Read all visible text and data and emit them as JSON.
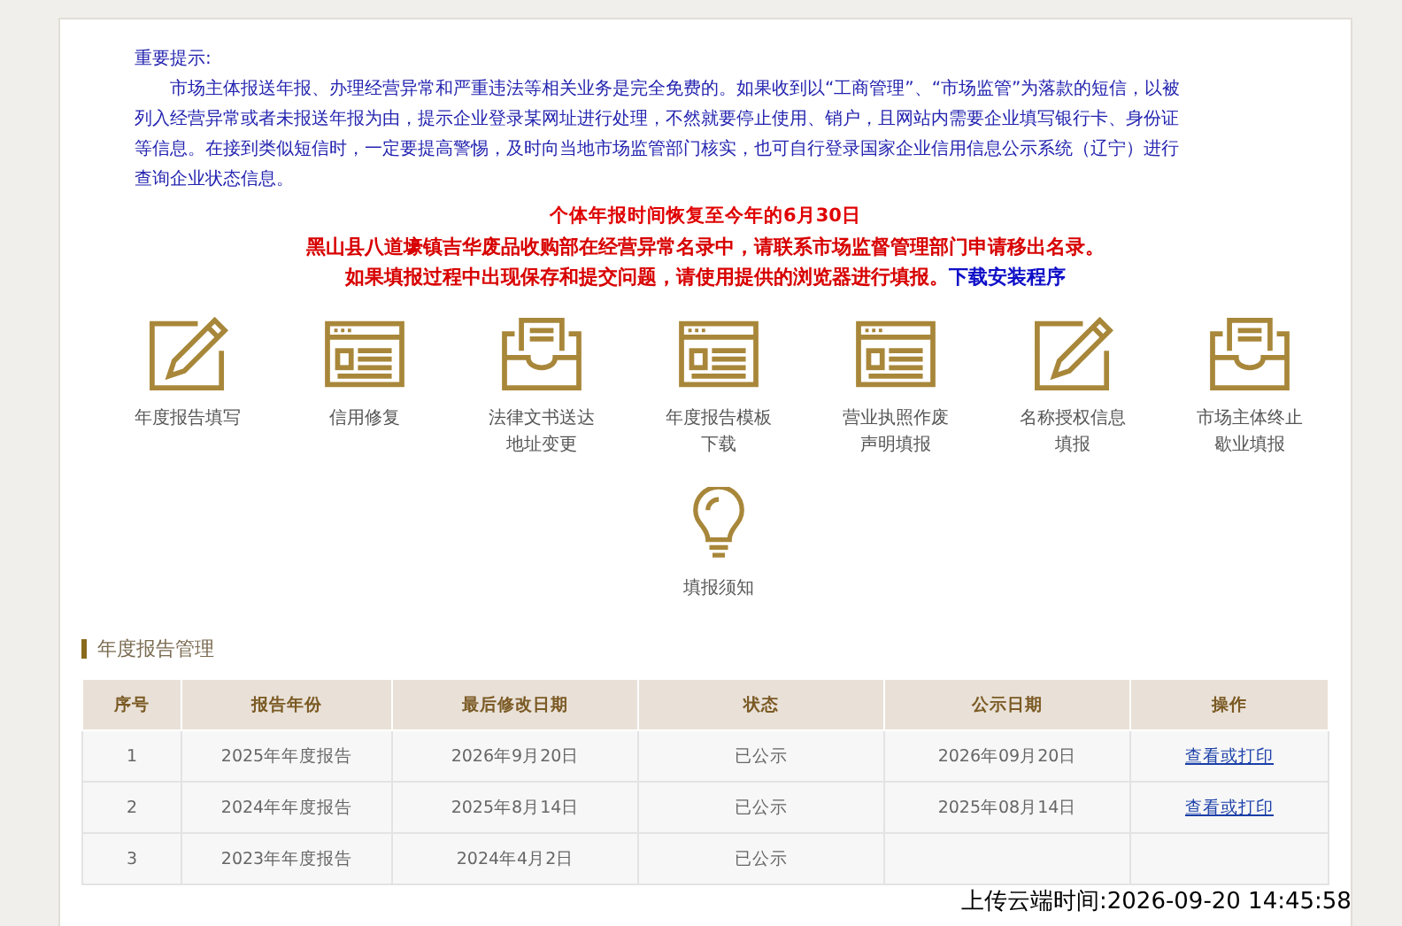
{
  "notice": {
    "heading": "重要提示:",
    "body": "市场主体报送年报、办理经营异常和严重违法等相关业务是完全免费的。如果收到以“工商管理”、“市场监管”为落款的短信，以被列入经营异常或者未报送年报为由，提示企业登录某网址进行处理，不然就要停止使用、销户，且网站内需要企业填写银行卡、身份证等信息。在接到类似短信时，一定要提高警惕，及时向当地市场监管部门核实，也可自行登录国家企业信用信息公示系统（辽宁）进行查询企业状态信息。"
  },
  "alerts": {
    "line_1": "个体年报时间恢复至今年的6月30日",
    "line_2": "黑山县八道壕镇吉华废品收购部在经营异常名录中，请联系市场监督管理部门申请移出名录。",
    "line_3": "如果填报过程中出现保存和提交问题，请使用提供的浏览器进行填报。",
    "download_link": "下载安装程序"
  },
  "services": [
    {
      "kind": "pencil",
      "label": "年度报告填写"
    },
    {
      "kind": "window",
      "label": "信用修复"
    },
    {
      "kind": "tray",
      "label": "法律文书送达地址变更"
    },
    {
      "kind": "window",
      "label": "年度报告模板下载"
    },
    {
      "kind": "window",
      "label": "营业执照作废声明填报"
    },
    {
      "kind": "pencil",
      "label": "名称授权信息填报"
    },
    {
      "kind": "tray",
      "label": "市场主体终止歇业填报"
    },
    {
      "kind": "bulb",
      "label": "填报须知"
    }
  ],
  "section_title": "年度报告管理",
  "table": {
    "columns": [
      "序号",
      "报告年份",
      "最后修改日期",
      "状态",
      "公示日期",
      "操作"
    ],
    "rows": [
      {
        "no": "1",
        "year": "2025年年度报告",
        "modified": "2026年9月20日",
        "status": "已公示",
        "public_date": "2026年09月20日",
        "action": "查看或打印"
      },
      {
        "no": "2",
        "year": "2024年年度报告",
        "modified": "2025年8月14日",
        "status": "已公示",
        "public_date": "2025年08月14日",
        "action": "查看或打印"
      },
      {
        "no": "3",
        "year": "2023年年度报告",
        "modified": "2024年4月2日",
        "status": "已公示"
      }
    ]
  },
  "overlay_caption": "上传云端时间:2026-09-20 14:45:58"
}
